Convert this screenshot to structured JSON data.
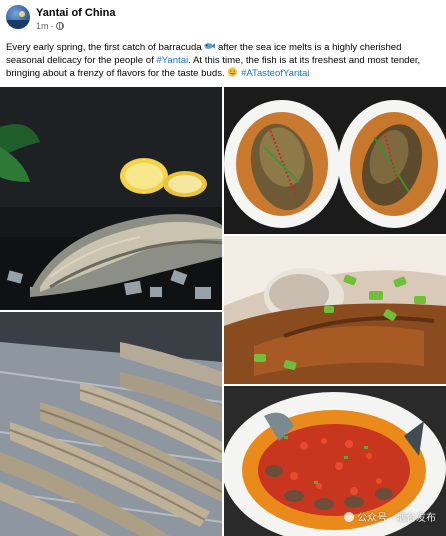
{
  "post": {
    "page_name": "Yantai of China",
    "time": "1m",
    "caption_1": "Every early spring, the first catch of barracuda ",
    "caption_2": " after the sea ice melts is a highly cherished seasonal delicacy for the people of ",
    "hashtag_city": "#Yantai",
    "caption_3": ". At this time, the fish is at its freshest and most tender, bringing about a frenzy of flavors for the taste buds. ",
    "hashtag_taste": "#ATasteofYantai",
    "emoji_fish": "fish-emoji",
    "emoji_smile": "smile-emoji"
  },
  "photos": [
    {
      "name": "raw-fish-on-ice-photo"
    },
    {
      "name": "braised-fish-plates-photo"
    },
    {
      "name": "braised-fish-closeup-photo"
    },
    {
      "name": "fish-market-tray-photo"
    },
    {
      "name": "steamed-fish-chili-photo"
    }
  ],
  "watermark": {
    "text": "公众号 · 烟台发布"
  },
  "colors": {
    "hashtag": "#1b74e4",
    "meta": "#65676b",
    "text": "#050505"
  }
}
